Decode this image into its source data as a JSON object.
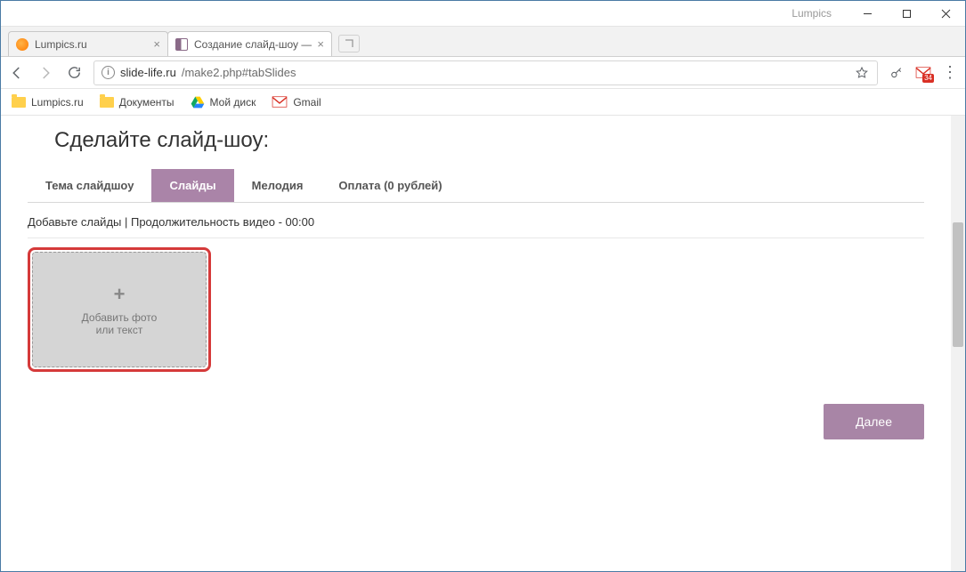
{
  "window": {
    "title": "Lumpics"
  },
  "tabs": [
    {
      "title": "Lumpics.ru",
      "active": false
    },
    {
      "title": "Создание слайд-шоу —",
      "active": true
    }
  ],
  "address": {
    "host": "slide-life.ru",
    "path": "/make2.php#tabSlides"
  },
  "gmail_badge": "34",
  "bookmarks": [
    {
      "label": "Lumpics.ru",
      "icon": "folder"
    },
    {
      "label": "Документы",
      "icon": "folder"
    },
    {
      "label": "Мой диск",
      "icon": "drive"
    },
    {
      "label": "Gmail",
      "icon": "gmail"
    }
  ],
  "page": {
    "heading": "Сделайте слайд-шоу:",
    "tabs": [
      {
        "label": "Тема слайдшоу",
        "active": false
      },
      {
        "label": "Слайды",
        "active": true
      },
      {
        "label": "Мелодия",
        "active": false
      },
      {
        "label": "Оплата (0 рублей)",
        "active": false
      }
    ],
    "subline": "Добавьте слайды | Продолжительность видео - 00:00",
    "add_card": {
      "plus": "+",
      "line1": "Добавить фото",
      "line2": "или текст"
    },
    "next_label": "Далее"
  }
}
